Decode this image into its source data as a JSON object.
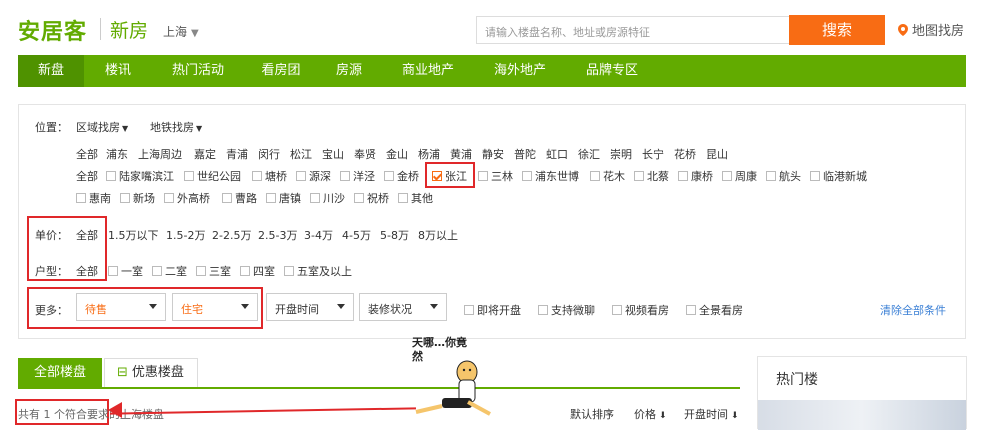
{
  "header": {
    "logo": "安居客",
    "channel": "新房",
    "city": "上海",
    "search_placeholder": "请输入楼盘名称、地址或房源特征",
    "search_button": "搜索",
    "map_link": "地图找房"
  },
  "nav": {
    "items": [
      "新盘",
      "楼讯",
      "热门活动",
      "看房团",
      "房源",
      "商业地产",
      "海外地产",
      "品牌专区"
    ]
  },
  "filters": {
    "location_label": "位置：",
    "location_modes": [
      "区域找房",
      "地铁找房"
    ],
    "districts": [
      "全部",
      "浦东",
      "上海周边",
      "嘉定",
      "青浦",
      "闵行",
      "松江",
      "宝山",
      "奉贤",
      "金山",
      "杨浦",
      "黄浦",
      "静安",
      "普陀",
      "虹口",
      "徐汇",
      "崇明",
      "长宁",
      "花桥",
      "昆山"
    ],
    "subareas_label": "全部",
    "subareas_row1": [
      "陆家嘴滨江",
      "世纪公园",
      "塘桥",
      "源深",
      "洋泾",
      "金桥",
      "张江",
      "三林",
      "浦东世博",
      "花木",
      "北蔡",
      "康桥",
      "周康",
      "航头",
      "临港新城"
    ],
    "subareas_row2": [
      "惠南",
      "新场",
      "外高桥",
      "曹路",
      "唐镇",
      "川沙",
      "祝桥",
      "其他"
    ],
    "price_label": "单价：",
    "price_options": [
      "全部",
      "1.5万以下",
      "1.5-2万",
      "2-2.5万",
      "2.5-3万",
      "3-4万",
      "4-5万",
      "5-8万",
      "8万以上"
    ],
    "layout_label": "户型：",
    "layout_options": [
      "全部",
      "一室",
      "二室",
      "三室",
      "四室",
      "五室及以上"
    ],
    "more_label": "更多：",
    "status_select": "待售",
    "type_select": "住宅",
    "open_time_select": "开盘时间",
    "decoration_select": "装修状况",
    "more_checks": [
      "即将开盘",
      "支持微聊",
      "视频看房",
      "全景看房"
    ],
    "clear_all": "清除全部条件"
  },
  "results": {
    "tab_all": "全部楼盘",
    "tab_promo": "优惠楼盘",
    "count_text": "共有 1 个符合要求的上海楼盘",
    "sort_default": "默认排序",
    "sort_price": "价格",
    "sort_open": "开盘时间"
  },
  "sidebar": {
    "title": "热门楼"
  },
  "annotation": {
    "text": "天哪…你竟然"
  },
  "colors": {
    "brand_green": "#62ab00",
    "accent_orange": "#f86c14",
    "highlight_red": "#e0282a"
  }
}
